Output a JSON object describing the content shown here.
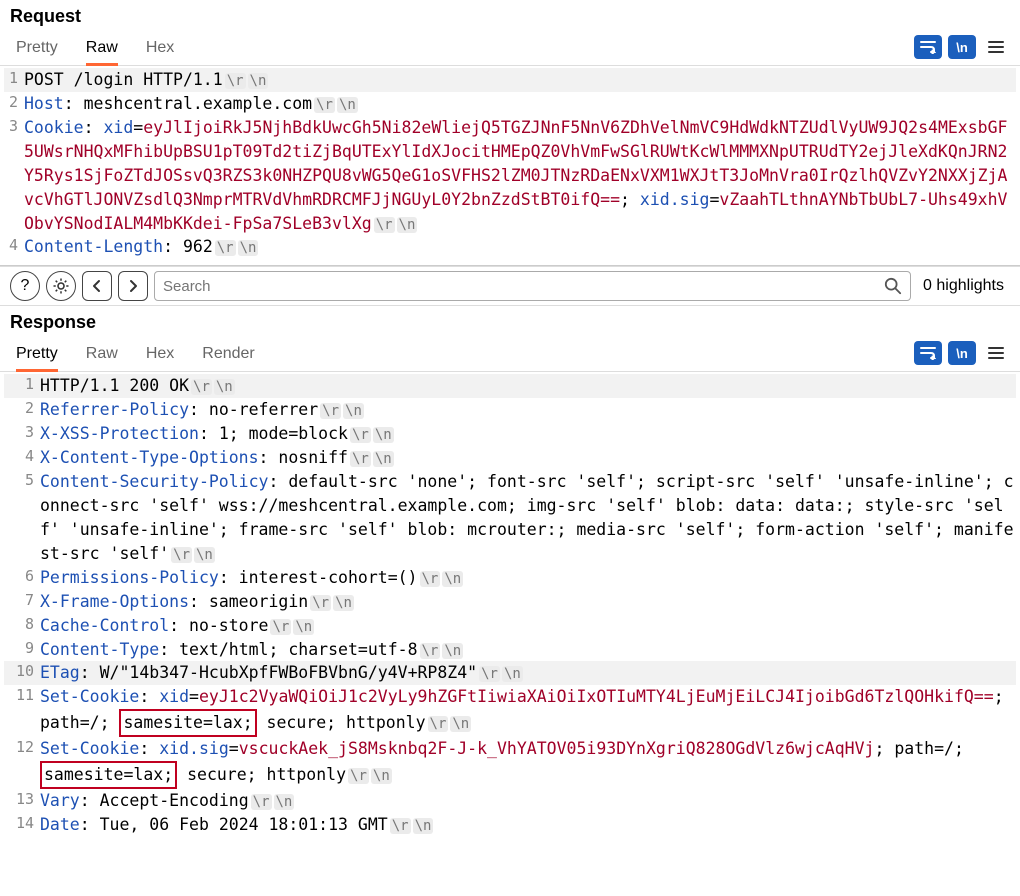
{
  "request": {
    "title": "Request",
    "tabs": {
      "pretty": "Pretty",
      "raw": "Raw",
      "hex": "Hex"
    },
    "activeTab": "Raw",
    "lines": [
      {
        "n": "1",
        "segments": [
          {
            "t": "plain",
            "v": "POST /login HTTP/1.1"
          },
          {
            "t": "crlf",
            "v": "\\r"
          },
          {
            "t": "crlf",
            "v": "\\n"
          }
        ],
        "hl": true
      },
      {
        "n": "2",
        "segments": [
          {
            "t": "hdr",
            "v": "Host"
          },
          {
            "t": "plain",
            "v": ": meshcentral.example.com"
          },
          {
            "t": "crlf",
            "v": "\\r"
          },
          {
            "t": "crlf",
            "v": "\\n"
          }
        ]
      },
      {
        "n": "3",
        "segments": [
          {
            "t": "hdr",
            "v": "Cookie"
          },
          {
            "t": "plain",
            "v": ": "
          },
          {
            "t": "cookie-name",
            "v": "xid"
          },
          {
            "t": "plain",
            "v": "="
          },
          {
            "t": "cookie-val",
            "v": "eyJlIjoiRkJ5NjhBdkUwcGh5Ni82eWliejQ5TGZJNnF5NnV6ZDhVelNmVC9HdWdkNTZUdlVyUW9JQ2s4MExsbGF5UWsrNHQxMFhibUpBSU1pT09Td2tiZjBqUTExYlIdXJocitHMEpQZ0VhVmFwSGlRUWtKcWlMMMXNpUTRUdTY2ejJleXdKQnJRN2Y5Rys1SjFoZTdJOSsvQ3RZS3k0NHZPQU8vWG5QeG1oSVFHS2lZM0JTNzRDaENxVXM1WXJtT3JoMnVra0IrQzlhQVZvY2NXXjZjAvcVhGTlJONVZsdlQ3NmprMTRVdVhmRDRCMFJjNGUyL0Y2bnZzdStBT0ifQ=="
          },
          {
            "t": "plain",
            "v": "; "
          },
          {
            "t": "cookie-name",
            "v": "xid.sig"
          },
          {
            "t": "plain",
            "v": "="
          },
          {
            "t": "cookie-val",
            "v": "vZaahTLthnAYNbTbUbL7-Uhs49xhVObvYSNodIALM4MbKKdei-FpSa7SLeB3vlXg"
          },
          {
            "t": "crlf",
            "v": "\\r"
          },
          {
            "t": "crlf",
            "v": "\\n"
          }
        ]
      },
      {
        "n": "4",
        "segments": [
          {
            "t": "hdr",
            "v": "Content-Length"
          },
          {
            "t": "plain",
            "v": ": 962"
          },
          {
            "t": "crlf",
            "v": "\\r"
          },
          {
            "t": "crlf",
            "v": "\\n"
          }
        ]
      }
    ]
  },
  "search": {
    "placeholder": "Search",
    "highlights": "0 highlights"
  },
  "response": {
    "title": "Response",
    "tabs": {
      "pretty": "Pretty",
      "raw": "Raw",
      "hex": "Hex",
      "render": "Render"
    },
    "activeTab": "Pretty",
    "lines": [
      {
        "n": "1",
        "segments": [
          {
            "t": "plain",
            "v": "HTTP/1.1 200 OK"
          },
          {
            "t": "crlf",
            "v": "\\r"
          },
          {
            "t": "crlf",
            "v": "\\n"
          }
        ],
        "hl": true
      },
      {
        "n": "2",
        "segments": [
          {
            "t": "hdr",
            "v": "Referrer-Policy"
          },
          {
            "t": "plain",
            "v": ": no-referrer"
          },
          {
            "t": "crlf",
            "v": "\\r"
          },
          {
            "t": "crlf",
            "v": "\\n"
          }
        ]
      },
      {
        "n": "3",
        "segments": [
          {
            "t": "hdr",
            "v": "X-XSS-Protection"
          },
          {
            "t": "plain",
            "v": ": 1; mode=block"
          },
          {
            "t": "crlf",
            "v": "\\r"
          },
          {
            "t": "crlf",
            "v": "\\n"
          }
        ]
      },
      {
        "n": "4",
        "segments": [
          {
            "t": "hdr",
            "v": "X-Content-Type-Options"
          },
          {
            "t": "plain",
            "v": ": nosniff"
          },
          {
            "t": "crlf",
            "v": "\\r"
          },
          {
            "t": "crlf",
            "v": "\\n"
          }
        ]
      },
      {
        "n": "5",
        "segments": [
          {
            "t": "hdr",
            "v": "Content-Security-Policy"
          },
          {
            "t": "plain",
            "v": ": default-src 'none'; font-src 'self'; script-src 'self' 'unsafe-inline'; connect-src 'self' wss://meshcentral.example.com; img-src 'self' blob: data: data:; style-src 'self' 'unsafe-inline'; frame-src 'self' blob: mcrouter:; media-src 'self'; form-action 'self'; manifest-src 'self'"
          },
          {
            "t": "crlf",
            "v": "\\r"
          },
          {
            "t": "crlf",
            "v": "\\n"
          }
        ]
      },
      {
        "n": "6",
        "segments": [
          {
            "t": "hdr",
            "v": "Permissions-Policy"
          },
          {
            "t": "plain",
            "v": ": interest-cohort=()"
          },
          {
            "t": "crlf",
            "v": "\\r"
          },
          {
            "t": "crlf",
            "v": "\\n"
          }
        ]
      },
      {
        "n": "7",
        "segments": [
          {
            "t": "hdr",
            "v": "X-Frame-Options"
          },
          {
            "t": "plain",
            "v": ": sameorigin"
          },
          {
            "t": "crlf",
            "v": "\\r"
          },
          {
            "t": "crlf",
            "v": "\\n"
          }
        ]
      },
      {
        "n": "8",
        "segments": [
          {
            "t": "hdr",
            "v": "Cache-Control"
          },
          {
            "t": "plain",
            "v": ": no-store"
          },
          {
            "t": "crlf",
            "v": "\\r"
          },
          {
            "t": "crlf",
            "v": "\\n"
          }
        ]
      },
      {
        "n": "9",
        "segments": [
          {
            "t": "hdr",
            "v": "Content-Type"
          },
          {
            "t": "plain",
            "v": ": text/html; charset=utf-8"
          },
          {
            "t": "crlf",
            "v": "\\r"
          },
          {
            "t": "crlf",
            "v": "\\n"
          }
        ]
      },
      {
        "n": "10",
        "segments": [
          {
            "t": "hdr",
            "v": "ETag"
          },
          {
            "t": "plain",
            "v": ": W/\"14b347-HcubXpfFWBoFBVbnG/y4V+RP8Z4\""
          },
          {
            "t": "crlf",
            "v": "\\r"
          },
          {
            "t": "crlf",
            "v": "\\n"
          }
        ],
        "hl": true
      },
      {
        "n": "11",
        "segments": [
          {
            "t": "hdr",
            "v": "Set-Cookie"
          },
          {
            "t": "plain",
            "v": ": "
          },
          {
            "t": "cookie-name",
            "v": "xid"
          },
          {
            "t": "plain",
            "v": "="
          },
          {
            "t": "cookie-val",
            "v": "eyJ1c2VyaWQiOiJ1c2VyLy9hZGFtIiwiaXAiOiIxOTIuMTY4LjEuMjEiLCJ4IjoibGd6TzlQOHkifQ=="
          },
          {
            "t": "plain",
            "v": "; path=/;"
          },
          {
            "t": "box",
            "v": "samesite=lax;"
          },
          {
            "t": "plain",
            "v": " secure; httponly"
          },
          {
            "t": "crlf",
            "v": "\\r"
          },
          {
            "t": "crlf",
            "v": "\\n"
          }
        ]
      },
      {
        "n": "12",
        "segments": [
          {
            "t": "hdr",
            "v": "Set-Cookie"
          },
          {
            "t": "plain",
            "v": ": "
          },
          {
            "t": "cookie-name",
            "v": "xid.sig"
          },
          {
            "t": "plain",
            "v": "="
          },
          {
            "t": "cookie-val",
            "v": "vscuckAek_jS8Msknbq2F-J-k_VhYATOV05i93DYnXgriQ828OGdVlz6wjcAqHVj"
          },
          {
            "t": "plain",
            "v": "; path=/;"
          },
          {
            "t": "box",
            "v": "samesite=lax;"
          },
          {
            "t": "plain",
            "v": " secure; httponly"
          },
          {
            "t": "crlf",
            "v": "\\r"
          },
          {
            "t": "crlf",
            "v": "\\n"
          }
        ]
      },
      {
        "n": "13",
        "segments": [
          {
            "t": "hdr",
            "v": "Vary"
          },
          {
            "t": "plain",
            "v": ": Accept-Encoding"
          },
          {
            "t": "crlf",
            "v": "\\r"
          },
          {
            "t": "crlf",
            "v": "\\n"
          }
        ]
      },
      {
        "n": "14",
        "segments": [
          {
            "t": "hdr",
            "v": "Date"
          },
          {
            "t": "plain",
            "v": ": Tue, 06 Feb 2024 18:01:13 GMT"
          },
          {
            "t": "crlf",
            "v": "\\r"
          },
          {
            "t": "crlf",
            "v": "\\n"
          }
        ]
      }
    ]
  }
}
